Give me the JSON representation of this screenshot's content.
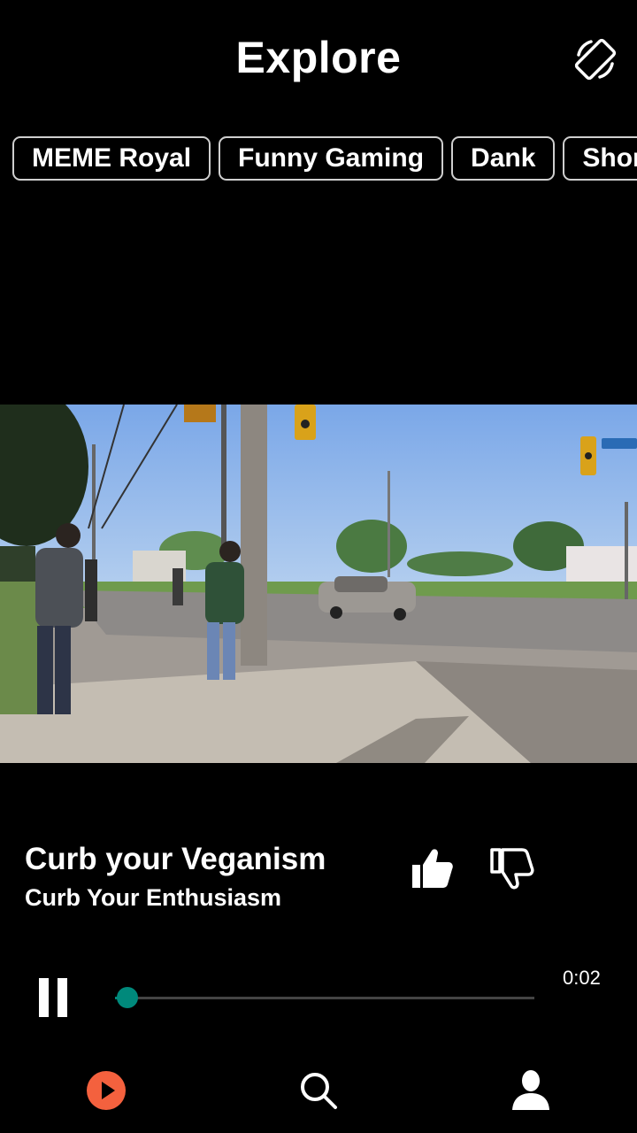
{
  "header": {
    "title": "Explore"
  },
  "categories": [
    "MEME Royal",
    "Funny Gaming",
    "Dank",
    "Short"
  ],
  "video": {
    "title": "Curb your Veganism",
    "channel": "Curb Your Enthusiasm"
  },
  "player": {
    "elapsed": "0:02",
    "progress": 0.03,
    "state": "playing"
  },
  "icons": {
    "rotate": "screen-rotation-icon",
    "like": "thumbs-up-icon",
    "dislike": "thumbs-down-icon",
    "pause": "pause-icon",
    "nav_play": "play-circle-icon",
    "nav_search": "search-icon",
    "nav_profile": "person-icon"
  },
  "colors": {
    "background": "#000000",
    "accent_play": "#f4613e",
    "progress": "#00897b"
  }
}
